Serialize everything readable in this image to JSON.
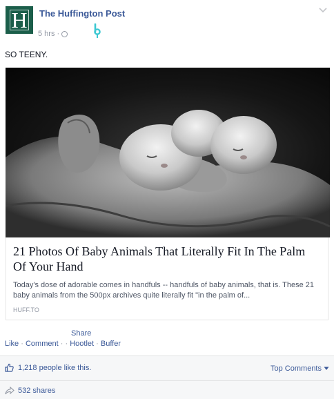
{
  "post": {
    "page_name": "The Huffington Post",
    "logo_letter": "H",
    "time": "5 hrs",
    "separator": "·",
    "caption": "SO TEENY."
  },
  "link_card": {
    "title": "21 Photos Of Baby Animals That Literally Fit In The Palm Of Your Hand",
    "description": "Today's dose of adorable comes in handfuls -- handfuls of baby animals, that is. These 21 baby animals from the 500px archives quite literally fit \"in the palm of...",
    "domain": "HUFF.TO"
  },
  "actions": {
    "share": "Share",
    "like": "Like",
    "comment": "Comment",
    "hootlet": "Hootlet",
    "buffer": "Buffer",
    "sep": "·"
  },
  "ufi": {
    "likes_text": "1,218 people like this.",
    "top_comments": "Top Comments",
    "shares_text": "532 shares"
  },
  "icons": {
    "logo": "huffington-post-logo",
    "privacy": "globe-icon",
    "extension": "hootlet-icon",
    "menu": "chevron-down-icon",
    "like": "thumbs-up-icon",
    "share": "share-arrow-icon"
  },
  "colors": {
    "brand_green": "#1b5e4a",
    "link_blue": "#3b5998",
    "meta_grey": "#9197a3",
    "hootlet_teal": "#3cc8d2"
  }
}
